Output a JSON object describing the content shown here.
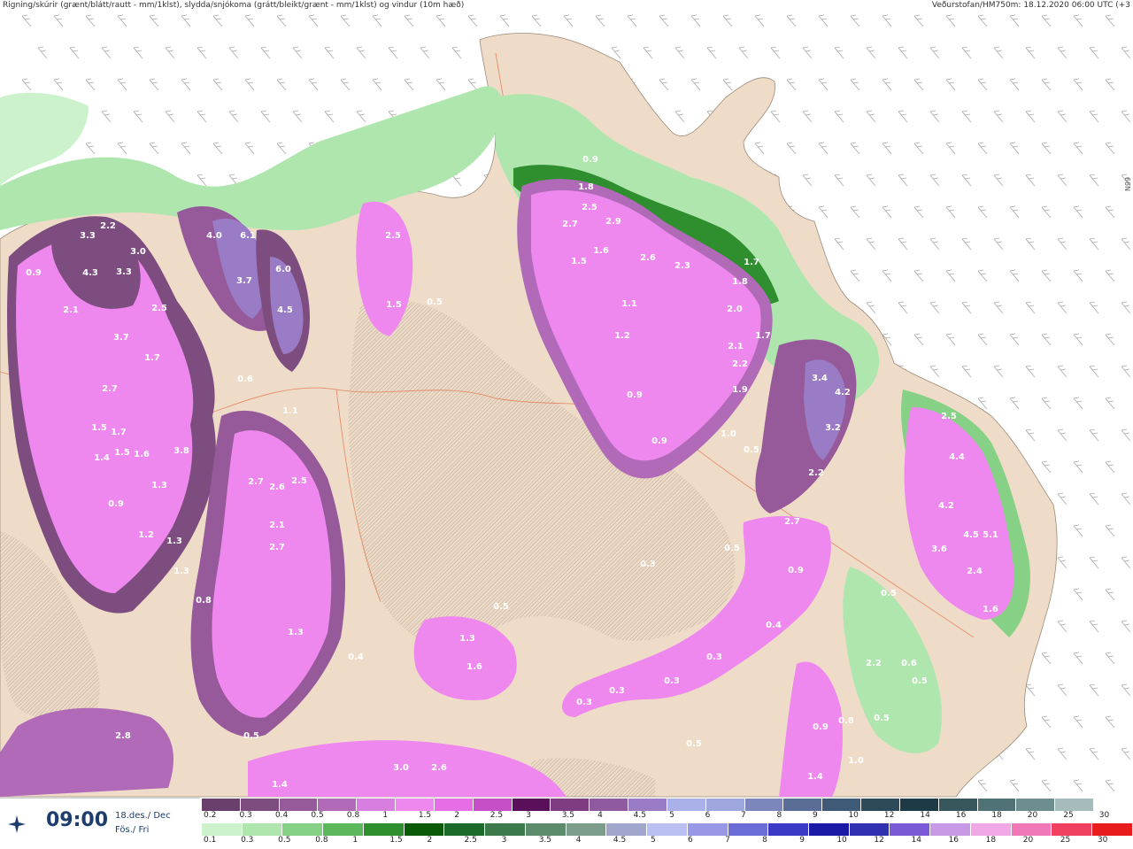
{
  "header": {
    "left": "Rigning/skúrir (grænt/blátt/rautt - mm/1klst), slydda/snjókoma (grátt/bleikt/grænt - mm/1klst) og vindur (10m hæð)",
    "right": "Veðurstofan/HM750m: 18.12.2020 06:00 UTC (+3"
  },
  "lat_label": "66N",
  "info": {
    "time": "09:00",
    "date": "18.des./ Dec",
    "day": "Fös./ Fri",
    "logo_icon": "vedurstofan-logo-icon"
  },
  "colors": {
    "land": "#efdcc8",
    "sea": "#ffffff",
    "snow_scale": [
      "#6b3f6b",
      "#7e4d80",
      "#96599a",
      "#b06ab8",
      "#d87ee0",
      "#ee88ee",
      "#e66de6",
      "#c64ec6",
      "#5a0f5a",
      "#7e3c82",
      "#8f5aa0",
      "#9a7cc6",
      "#aab0e8",
      "#9fa6de",
      "#7c86ba",
      "#5a6d96",
      "#3f5a76",
      "#2e4a5a",
      "#1e3a46",
      "#36585c",
      "#4e7276",
      "#6d8e90",
      "#a6bcbc",
      "#ffffff"
    ],
    "rain_scale": [
      "#ccf2cc",
      "#aee6ae",
      "#86d186",
      "#5cb85c",
      "#2f8f2f",
      "#0a5a0a",
      "#1a6a2a",
      "#3c7a4c",
      "#5c8c6c",
      "#7c9c8c",
      "#a0a6cc",
      "#b9bff0",
      "#9898e6",
      "#6c6cd6",
      "#3a3ac6",
      "#1a1aa6",
      "#3030b0",
      "#7a5ad6",
      "#c89ae6",
      "#f0a8e6",
      "#f078b8",
      "#f04060",
      "#e81c1c"
    ]
  },
  "legend": {
    "snow_labels": [
      "0.2",
      "0.3",
      "0.4",
      "0.5",
      "0.8",
      "1",
      "1.5",
      "2",
      "2.5",
      "3",
      "3.5",
      "4",
      "4.5",
      "5",
      "6",
      "7",
      "8",
      "9",
      "10",
      "12",
      "14",
      "16",
      "18",
      "20",
      "25",
      "30"
    ],
    "rain_labels": [
      "0.1",
      "0.3",
      "0.5",
      "0.8",
      "1",
      "1.5",
      "2",
      "2.5",
      "3",
      "3.5",
      "4",
      "4.5",
      "5",
      "6",
      "7",
      "8",
      "9",
      "10",
      "12",
      "14",
      "16",
      "18",
      "20",
      "25",
      "30"
    ]
  },
  "map_values": [
    {
      "t": "3.3"
    },
    {
      "t": "2.2"
    },
    {
      "t": "3.0"
    },
    {
      "t": "4.3"
    },
    {
      "t": "3.3"
    },
    {
      "t": "0.9"
    },
    {
      "t": "2.1"
    },
    {
      "t": "2.5"
    },
    {
      "t": "3.7"
    },
    {
      "t": "1.7"
    },
    {
      "t": "2.7"
    },
    {
      "t": "1.5"
    },
    {
      "t": "1.7"
    },
    {
      "t": "1.4"
    },
    {
      "t": "1.5"
    },
    {
      "t": "1.6"
    },
    {
      "t": "3.8"
    },
    {
      "t": "1.3"
    },
    {
      "t": "0.9"
    },
    {
      "t": "1.2"
    },
    {
      "t": "1.3"
    },
    {
      "t": "1.3"
    },
    {
      "t": "0.8"
    },
    {
      "t": "4.0"
    },
    {
      "t": "6.1"
    },
    {
      "t": "3.7"
    },
    {
      "t": "6.0"
    },
    {
      "t": "4.5"
    },
    {
      "t": "0.6"
    },
    {
      "t": "1.1"
    },
    {
      "t": "2.7"
    },
    {
      "t": "2.6"
    },
    {
      "t": "2.5"
    },
    {
      "t": "2.1"
    },
    {
      "t": "2.7"
    },
    {
      "t": "1.3"
    },
    {
      "t": "0.4"
    },
    {
      "t": "0.5"
    },
    {
      "t": "2.5"
    },
    {
      "t": "1.5"
    },
    {
      "t": "0.5"
    },
    {
      "t": "0.9"
    },
    {
      "t": "1.8"
    },
    {
      "t": "2.5"
    },
    {
      "t": "2.7"
    },
    {
      "t": "2.9"
    },
    {
      "t": "1.5"
    },
    {
      "t": "1.6"
    },
    {
      "t": "2.6"
    },
    {
      "t": "2.3"
    },
    {
      "t": "1.7"
    },
    {
      "t": "1.8"
    },
    {
      "t": "1.1"
    },
    {
      "t": "2.0"
    },
    {
      "t": "1.2"
    },
    {
      "t": "2.1"
    },
    {
      "t": "2.2"
    },
    {
      "t": "0.9"
    },
    {
      "t": "1.9"
    },
    {
      "t": "0.9"
    },
    {
      "t": "1.0"
    },
    {
      "t": "0.5"
    },
    {
      "t": "1.7"
    },
    {
      "t": "3.4"
    },
    {
      "t": "4.2"
    },
    {
      "t": "3.2"
    },
    {
      "t": "2.2"
    },
    {
      "t": "2.7"
    },
    {
      "t": "0.5"
    },
    {
      "t": "0.9"
    },
    {
      "t": "0.4"
    },
    {
      "t": "0.3"
    },
    {
      "t": "0.3"
    },
    {
      "t": "0.3"
    },
    {
      "t": "0.3"
    },
    {
      "t": "0.3"
    },
    {
      "t": "1.3"
    },
    {
      "t": "1.6"
    },
    {
      "t": "0.5"
    },
    {
      "t": "2.8"
    },
    {
      "t": "1.4"
    },
    {
      "t": "3.0"
    },
    {
      "t": "2.6"
    },
    {
      "t": "2.5"
    },
    {
      "t": "4.4"
    },
    {
      "t": "4.2"
    },
    {
      "t": "3.6"
    },
    {
      "t": "4.5"
    },
    {
      "t": "5.1"
    },
    {
      "t": "2.4"
    },
    {
      "t": "1.6"
    },
    {
      "t": "0.5"
    },
    {
      "t": "2.2"
    },
    {
      "t": "0.6"
    },
    {
      "t": "0.5"
    },
    {
      "t": "0.9"
    },
    {
      "t": "0.8"
    },
    {
      "t": "0.5"
    },
    {
      "t": "1.0"
    },
    {
      "t": "1.4"
    },
    {
      "t": "0.5"
    }
  ]
}
